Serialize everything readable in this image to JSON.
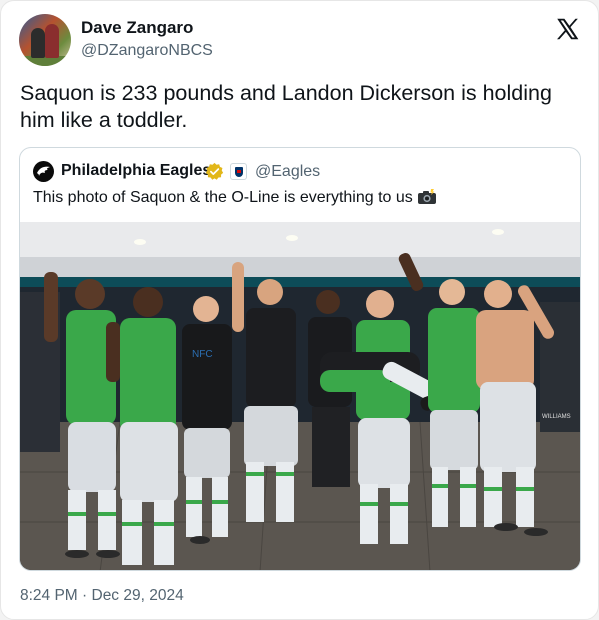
{
  "author": {
    "name": "Dave Zangaro",
    "handle": "@DZangaroNBCS"
  },
  "tweet": {
    "text": "Saquon is 233 pounds and Landon Dickerson is holding him like a toddler.",
    "timestamp": "8:24 PM · Dec 29, 2024"
  },
  "quoted_tweet": {
    "name": "Philadelphia Eagles",
    "handle": "@Eagles",
    "text": "This photo of Saquon & the O-Line is everything to us",
    "verified_badge_icon": "gold-verified-icon",
    "affiliate_badge_icon": "nfl-shield-icon",
    "trailing_emoji_icon": "camera-with-flash-icon"
  },
  "photo": {
    "description_icon": "team-locker-room-photo",
    "jersey_text": "WILLIAMS"
  },
  "colors": {
    "text_primary": "#0f1419",
    "text_secondary": "#536471",
    "border": "#cfd9de",
    "verified_gold": "#e2b719",
    "eagles_green": "#3aa84a",
    "eagles_midnight": "#004c54"
  }
}
